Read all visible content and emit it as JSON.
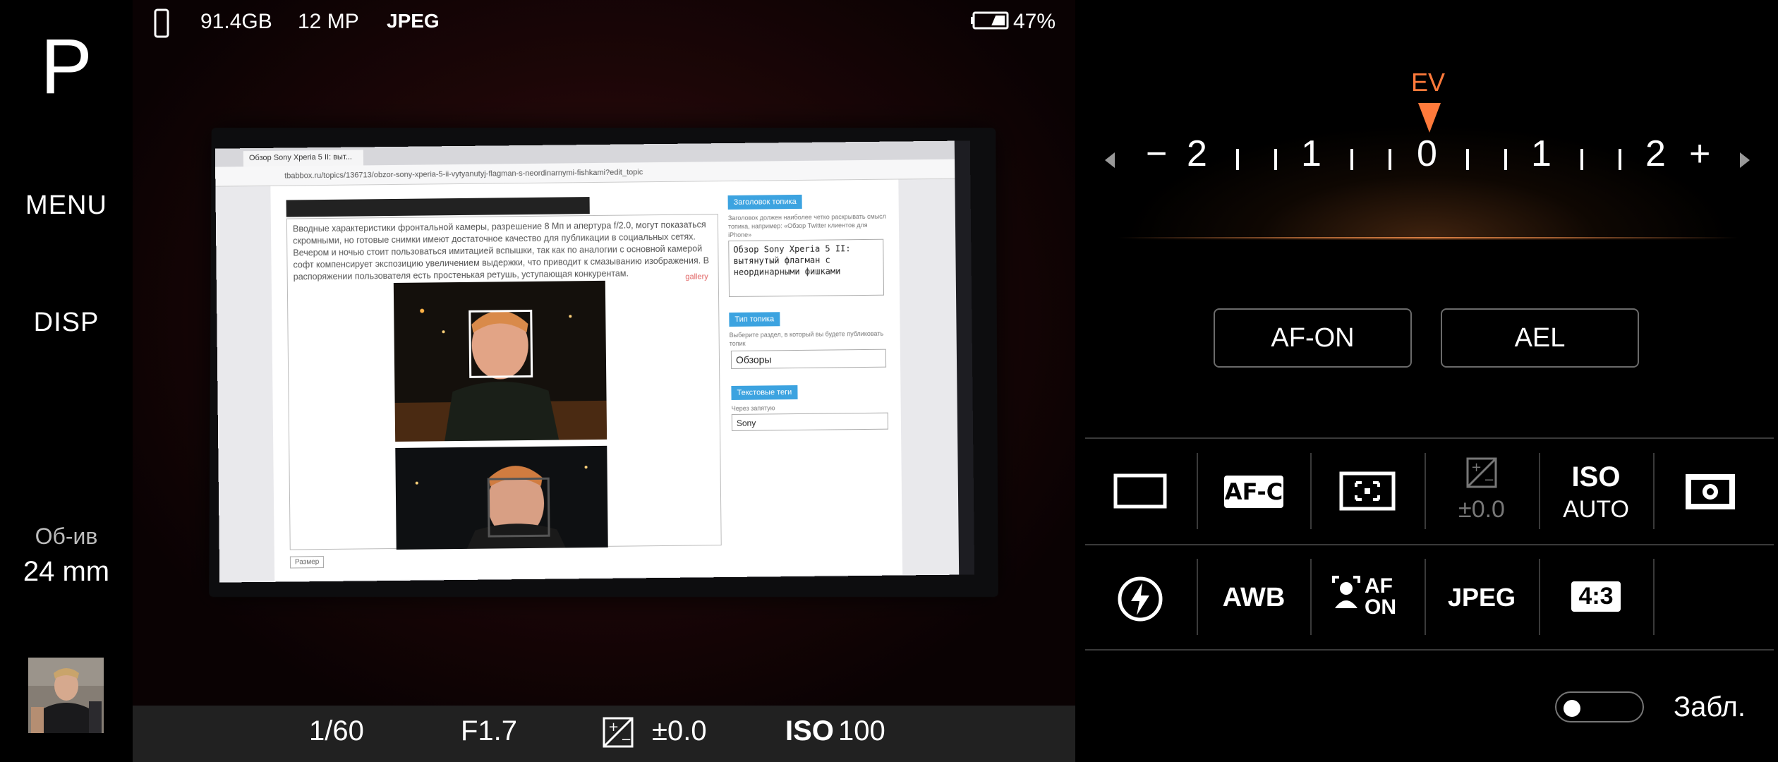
{
  "left": {
    "mode": "P",
    "menu_label": "MENU",
    "disp_label": "DISP",
    "lens_label": "Об-ив",
    "lens_value": "24 mm"
  },
  "status": {
    "storage": "91.4GB",
    "resolution": "12 MP",
    "format": "JPEG",
    "battery": "47%",
    "battery_level": 0.47
  },
  "preview": {
    "tab_title": "Обзор Sony Xperia 5 II: выт...",
    "url": "tbabbox.ru/topics/136713/obzor-sony-xperia-5-ii-vytyanutyj-flagman-s-neordinarnymi-fishkami?edit_topic",
    "article_text": "Вводные характеристики фронтальной камеры, разрешение 8 Мп и апертура f/2.0, могут показаться скромными, но готовые снимки имеют достаточное качество для публикации в социальных сетях. Вечером и ночью стоит пользоваться имитацией вспышки, так как по аналогии с основной камерой софт компенсирует экспозицию увеличением выдержки, что приводит к смазыванию изображения. В распоряжении пользователя есть простенькая ретушь, уступающая конкурентам.",
    "gallery_tag": "gallery",
    "size_button": "Размер",
    "title_label": "Заголовок топика",
    "title_note": "Заголовок должен наиболее четко раскрывать смысл топика, например: «Обзор Twitter клиентов для iPhone»",
    "title_value": "Обзор Sony Xperia 5 II: вытянутый флагман с неординарными фишками",
    "type_label": "Тип топика",
    "type_note": "Выберите раздел, в который вы будете публиковать топик",
    "type_value": "Обзоры",
    "tags_label": "Текстовые теги",
    "tags_note": "Через запятую",
    "tags_value": "Sony"
  },
  "exposure": {
    "shutter": "1/60",
    "aperture": "F1.7",
    "ev_value": "±0.0",
    "iso_label": "ISO",
    "iso_value": "100"
  },
  "ev_scale": {
    "title": "EV",
    "labels": [
      "−",
      "2",
      "1",
      "0",
      "1",
      "2",
      "+"
    ],
    "current": 0
  },
  "buttons": {
    "af_on": "AF-ON",
    "ael": "AEL"
  },
  "settings": {
    "af_mode": "AF-C",
    "ev_comp": "±0.0",
    "iso_top": "ISO",
    "iso_bottom": "AUTO",
    "wb": "AWB",
    "face_af_top": "AF",
    "face_af_bottom": "ON",
    "file_format": "JPEG",
    "aspect": "4:3"
  },
  "lock": {
    "label": "Забл.",
    "enabled": false
  },
  "colors": {
    "accent": "#ff7a3b",
    "panel_bg": "#000000",
    "exposure_bar_bg": "#212121",
    "grid_line": "#3a3a3a"
  }
}
